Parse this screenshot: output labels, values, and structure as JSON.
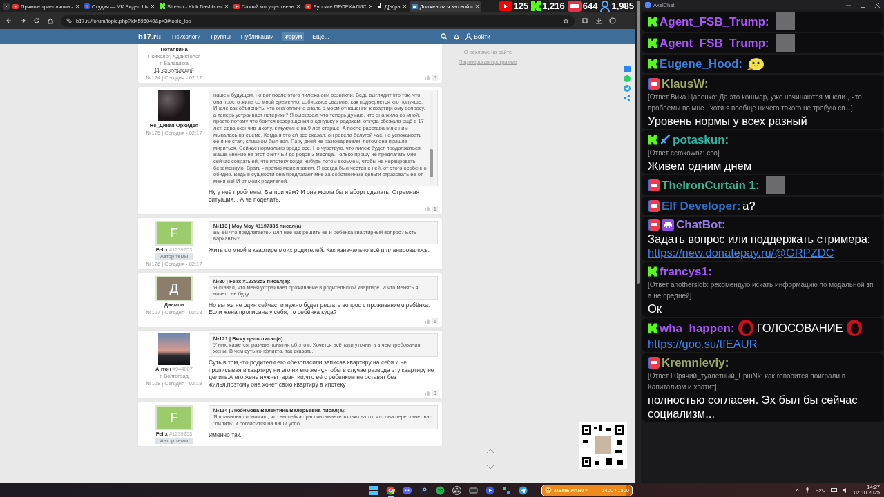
{
  "browser": {
    "tabs": [
      {
        "kind": "youtube",
        "label": "Прямые трансляции -",
        "selected": false
      },
      {
        "kind": "vk",
        "label": "Студия — VK Видео Liv",
        "selected": false
      },
      {
        "kind": "kick",
        "label": "Stream - Kick Dashboar",
        "selected": false
      },
      {
        "kind": "youtube",
        "label": "Самый могущественн",
        "selected": false
      },
      {
        "kind": "youtube",
        "label": "Русские ПРОЕХАЛИС",
        "selected": false
      },
      {
        "kind": "note",
        "label": "Д[ы]ра",
        "selected": false
      },
      {
        "kind": "site",
        "label": "Должен ли я за свой с",
        "selected": true
      }
    ],
    "address": "b17.ru/forum/topic.php?id=596040&p=3#topic_top"
  },
  "stream_stats": [
    {
      "kind": "youtube",
      "count": "125"
    },
    {
      "kind": "kick",
      "count": "1,216"
    },
    {
      "kind": "live",
      "count": "644"
    },
    {
      "kind": "viewers",
      "count": "1,985"
    }
  ],
  "site_nav": {
    "logo": "b17.ru",
    "items": [
      {
        "label": "Психологи",
        "selected": false
      },
      {
        "label": "Группы",
        "selected": false
      },
      {
        "label": "Публикации",
        "selected": false
      },
      {
        "label": "Форум",
        "selected": true
      },
      {
        "label": "Ещё...",
        "selected": false
      }
    ],
    "login": "Войти"
  },
  "posts": [
    {
      "author": {
        "name": "Потапкина",
        "lines": [
          "Психолог, Аддиктолог",
          "г. Балашиха"
        ],
        "link": "11 консультаций"
      },
      "meta": "№124 | Сегодня - 02:17",
      "likes": "5"
    },
    {
      "author": {
        "name": "Не_Дикая Орхидея",
        "avatar": {
          "kind": "photo"
        }
      },
      "meta": "№125 | Сегодня - 02:17",
      "quote": {
        "scrollable": true,
        "text": "нашем будущем, но вот после этого пилежа они возникли. Ведь выглядит это так, что она просто жила со мной временно, собираясь свалить, как подвернется кто получше. Иначе как объяснить, что она отлично знала о моем отношении к квартирному вопросу, а теперь устраивает истерики? Я высказал, что теперь думаю, что она жила со мной, просто потому что боится возвращения в однушку к родакам, откуда сбежала ещё в 17 лет, едва окончив школу, к мужчине на 9 лет старше. А после расставания с ним мыкалась на съеме. Когда я это ей все сказал, он ревела белугой час, но успокаивать ее я не стал, слишком был зол. Пару дней не разговаривали, потом она пришла мириться. Сейчас нормально вроде все. Но чувствую, что пилеж будет продолжаться. Ваше мнение на этот счет? Ей до родов 3 месяца. Только прошу не предлагать мне сейчас соврать ей, что ипотеку когда-нибудь потом возьмем, чтобы не нервировать беременную. Врать - против моих правил. Я всегда был честен с ней, от этого особенно обидно. Ведь в сущности она предлагает мне за собственные деньги страховать её от меня же! И от моих родителей."
      },
      "text": "Ну у неё проблемы. Вы при чём? И она могла бы и аборт сделать. Стремная ситуация... А че поделать.",
      "likes": "1"
    },
    {
      "author": {
        "name": "Felix",
        "id": "#1239253",
        "badge": "Автор темы",
        "avatar": {
          "kind": "letter",
          "letter": "F",
          "color": "#9ccb6c"
        }
      },
      "meta": "№126 | Сегодня - 02:17",
      "quote": {
        "scrollable": false,
        "header": "№113 | Моу Моу #1197336 писал(а):",
        "text": "Вы ей что предлагаете? Для нее как решить ее и ребенка квартирный вопрос? Есть варианты?"
      },
      "text": "Жить со мной в квартире моих родителей. Как изначально всё и планировалось."
    },
    {
      "author": {
        "name": "Диамон",
        "avatar": {
          "kind": "letter",
          "letter": "Д",
          "color": "#8d7d6c"
        }
      },
      "meta": "№127 | Сегодня - 02:18",
      "quote": {
        "scrollable": false,
        "header": "№80 | Felix #1239253 писал(а):",
        "text": "Я сказал, что меня устраивает проживание в родительской квартире. И что менять я ничего не буду."
      },
      "text": "Но вы же не один сейчас, и нужно будет решать вопрос с проживанием ребёнка. Если жена прописана у себя, то ребёнка куда?",
      "likes": "1"
    },
    {
      "author": {
        "name": "Антон",
        "id": "#944007",
        "lines": [
          "г. Волгоград"
        ],
        "avatar": {
          "kind": "photo"
        }
      },
      "meta": "№128 | Сегодня - 02:18",
      "quote": {
        "scrollable": false,
        "header": "№121 | Вижу цель писал(а):",
        "text": "У них, кажется, разные понятия об этом. Хочется всё таки уточнить в чем требования жены. В чем суть конфликта, так сказать."
      },
      "text": "Суть в том,что родители его обезопасили,записав квартиру на себя и не прописывая в квартиру ни его ни его жену,чтобы в случае развода эту квартиру не делить.А его жене нужны гарантии,что её с ребенком не оставят без жилья,поэтому она хочет свою квартиру в ипотеку",
      "likes": "3"
    },
    {
      "author": {
        "name": "Felix",
        "id": "#1239253",
        "badge": "Автор темы",
        "avatar": {
          "kind": "letter",
          "letter": "F",
          "color": "#9ccb6c"
        }
      },
      "quote": {
        "scrollable": false,
        "header": "№114 | Любимова Валентина Валерьевна писал(а):",
        "text": "Я правильно понимаю, что вы сейчас рассчитываете только на то, что она перестанет вас \"пилить\" и согласится на ваши усло"
      },
      "text": "Именно так."
    }
  ],
  "sidebar_links": [
    "О рекламе на сайте",
    "Партнерская программа"
  ],
  "chat": {
    "title": "AxelChat",
    "messages": [
      {
        "kind": "kick",
        "name": "Agent_FSB_Trump:",
        "color": "#a855f7",
        "parts": [
          {
            "kind": "photo"
          }
        ]
      },
      {
        "kind": "kick",
        "name": "Agent_FSB_Trump:",
        "color": "#a855f7",
        "parts": [
          {
            "kind": "photo"
          }
        ]
      },
      {
        "kind": "kick",
        "name": "Eugene_Hood:",
        "color": "#3b7fd9",
        "parts": [
          {
            "kind": "blob"
          }
        ]
      },
      {
        "kind": "live",
        "name": "KlausW:",
        "color": "#a3ad66",
        "reply": "[Ответ Вика Цапенко: Да это кошмар, уже начинаются мысли , что проблемы во мне , хотя я вообще ничего такого не требую св...]",
        "parts": [
          {
            "kind": "text",
            "text": "Уровень нормы у всех разный"
          }
        ]
      },
      {
        "kind": "kick",
        "badges": [
          {
            "kind": "sword"
          }
        ],
        "name": "potaskun:",
        "color": "#2fb5a5",
        "reply": "[Ответ ccmkownz: сво]",
        "parts": [
          {
            "kind": "text",
            "text": "Живем одним днем"
          }
        ]
      },
      {
        "kind": "live",
        "name": "TheIronCurtain 1:",
        "color": "#39b28f",
        "parts": [
          {
            "kind": "photo"
          }
        ]
      },
      {
        "kind": "live",
        "name": "Elf Developer:",
        "color": "#2f6fc4",
        "parts": [
          {
            "kind": "text",
            "text": "а?"
          }
        ]
      },
      {
        "kind": "live",
        "badges": [
          {
            "kind": "invader"
          }
        ],
        "name": "ChatBot:",
        "color": "#9b7cf0",
        "parts": [
          {
            "kind": "text",
            "text": "Задать вопрос или поддержать стримера:"
          },
          {
            "kind": "link",
            "text": "https://new.donatepay.ru/@GRPZDC"
          }
        ]
      },
      {
        "kind": "kick",
        "name": "francys1:",
        "color": "#a855f7",
        "reply": "[Ответ anotherslob: рекомендую искать информацию по модальной зп а не средней]",
        "parts": [
          {
            "kind": "text",
            "text": "Ок"
          }
        ]
      },
      {
        "kind": "kick",
        "name": "wha_happen:",
        "color": "#a855f7",
        "parts": [
          {
            "kind": "ring"
          },
          {
            "kind": "text",
            "text": "ГОЛОСОВАНИЕ"
          },
          {
            "kind": "ring"
          },
          {
            "kind": "link",
            "text": "https://goo.su/tfEAUR"
          }
        ]
      },
      {
        "kind": "live",
        "name": "Kremnieviy:",
        "color": "#9aa86a",
        "reply": "[Ответ Г0рячий_туалетный_ЕршNk: как говорится поиграли в Капитализм и хватит]",
        "parts": [
          {
            "kind": "text",
            "text": "полностью согласен. Эх был бы сейчас социализм..."
          }
        ]
      }
    ]
  },
  "taskbar": {
    "apps": [
      {
        "kind": "start",
        "active": false
      },
      {
        "kind": "chrome",
        "active": true
      },
      {
        "kind": "discord",
        "active": false
      },
      {
        "kind": "steam",
        "active": false
      },
      {
        "kind": "spotify",
        "active": false
      },
      {
        "kind": "obs",
        "active": false
      },
      {
        "kind": "screen",
        "active": false
      },
      {
        "kind": "play",
        "active": false
      },
      {
        "kind": "grid",
        "active": false
      },
      {
        "kind": "telegram",
        "active": false
      }
    ],
    "widget": {
      "title": "MEME PARTY",
      "reading": "1400 / 1500",
      "level": 0.93
    },
    "tray": {
      "language": "РУС",
      "time": "14:27",
      "date": "02.10.2025"
    }
  }
}
